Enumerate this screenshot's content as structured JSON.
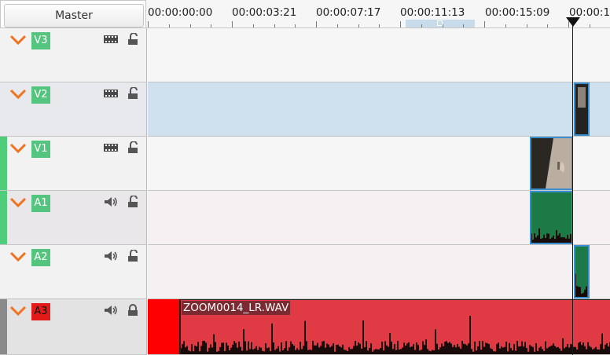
{
  "master": {
    "label": "Master"
  },
  "ruler": {
    "timecodes": [
      "00:00:00:00",
      "00:00:03:21",
      "00:00:07:17",
      "00:00:11:13",
      "00:00:15:09",
      "00:00:1"
    ]
  },
  "tracks": [
    {
      "name": "V3",
      "type": "video",
      "icon": "film-icon",
      "lock_icon": "unlock-icon",
      "active": false
    },
    {
      "name": "V2",
      "type": "video",
      "icon": "film-icon",
      "lock_icon": "unlock-icon",
      "active": false,
      "selected": true
    },
    {
      "name": "V1",
      "type": "video",
      "icon": "film-icon",
      "lock_icon": "unlock-icon",
      "active": true
    },
    {
      "name": "A1",
      "type": "audio",
      "icon": "speaker-icon",
      "lock_icon": "unlock-icon",
      "active": true
    },
    {
      "name": "A2",
      "type": "audio",
      "icon": "speaker-icon",
      "lock_icon": "unlock-icon",
      "active": false
    },
    {
      "name": "A3",
      "type": "audio",
      "icon": "speaker-icon",
      "lock_icon": "lock-icon",
      "active": false,
      "locked": true
    }
  ],
  "clips": {
    "a3_clip_name": "ZOOM0014_LR.WAV"
  },
  "colors": {
    "track_active_green": "#4fcd7a",
    "badge_green": "#54c57e",
    "badge_red": "#e31a1a",
    "clip_red": "#e03a44",
    "clip_border": "#3a8fd0",
    "audio_clip_green": "#1c7a46",
    "selected_row": "#cfe0ee",
    "accent_orange": "#f0731f"
  }
}
